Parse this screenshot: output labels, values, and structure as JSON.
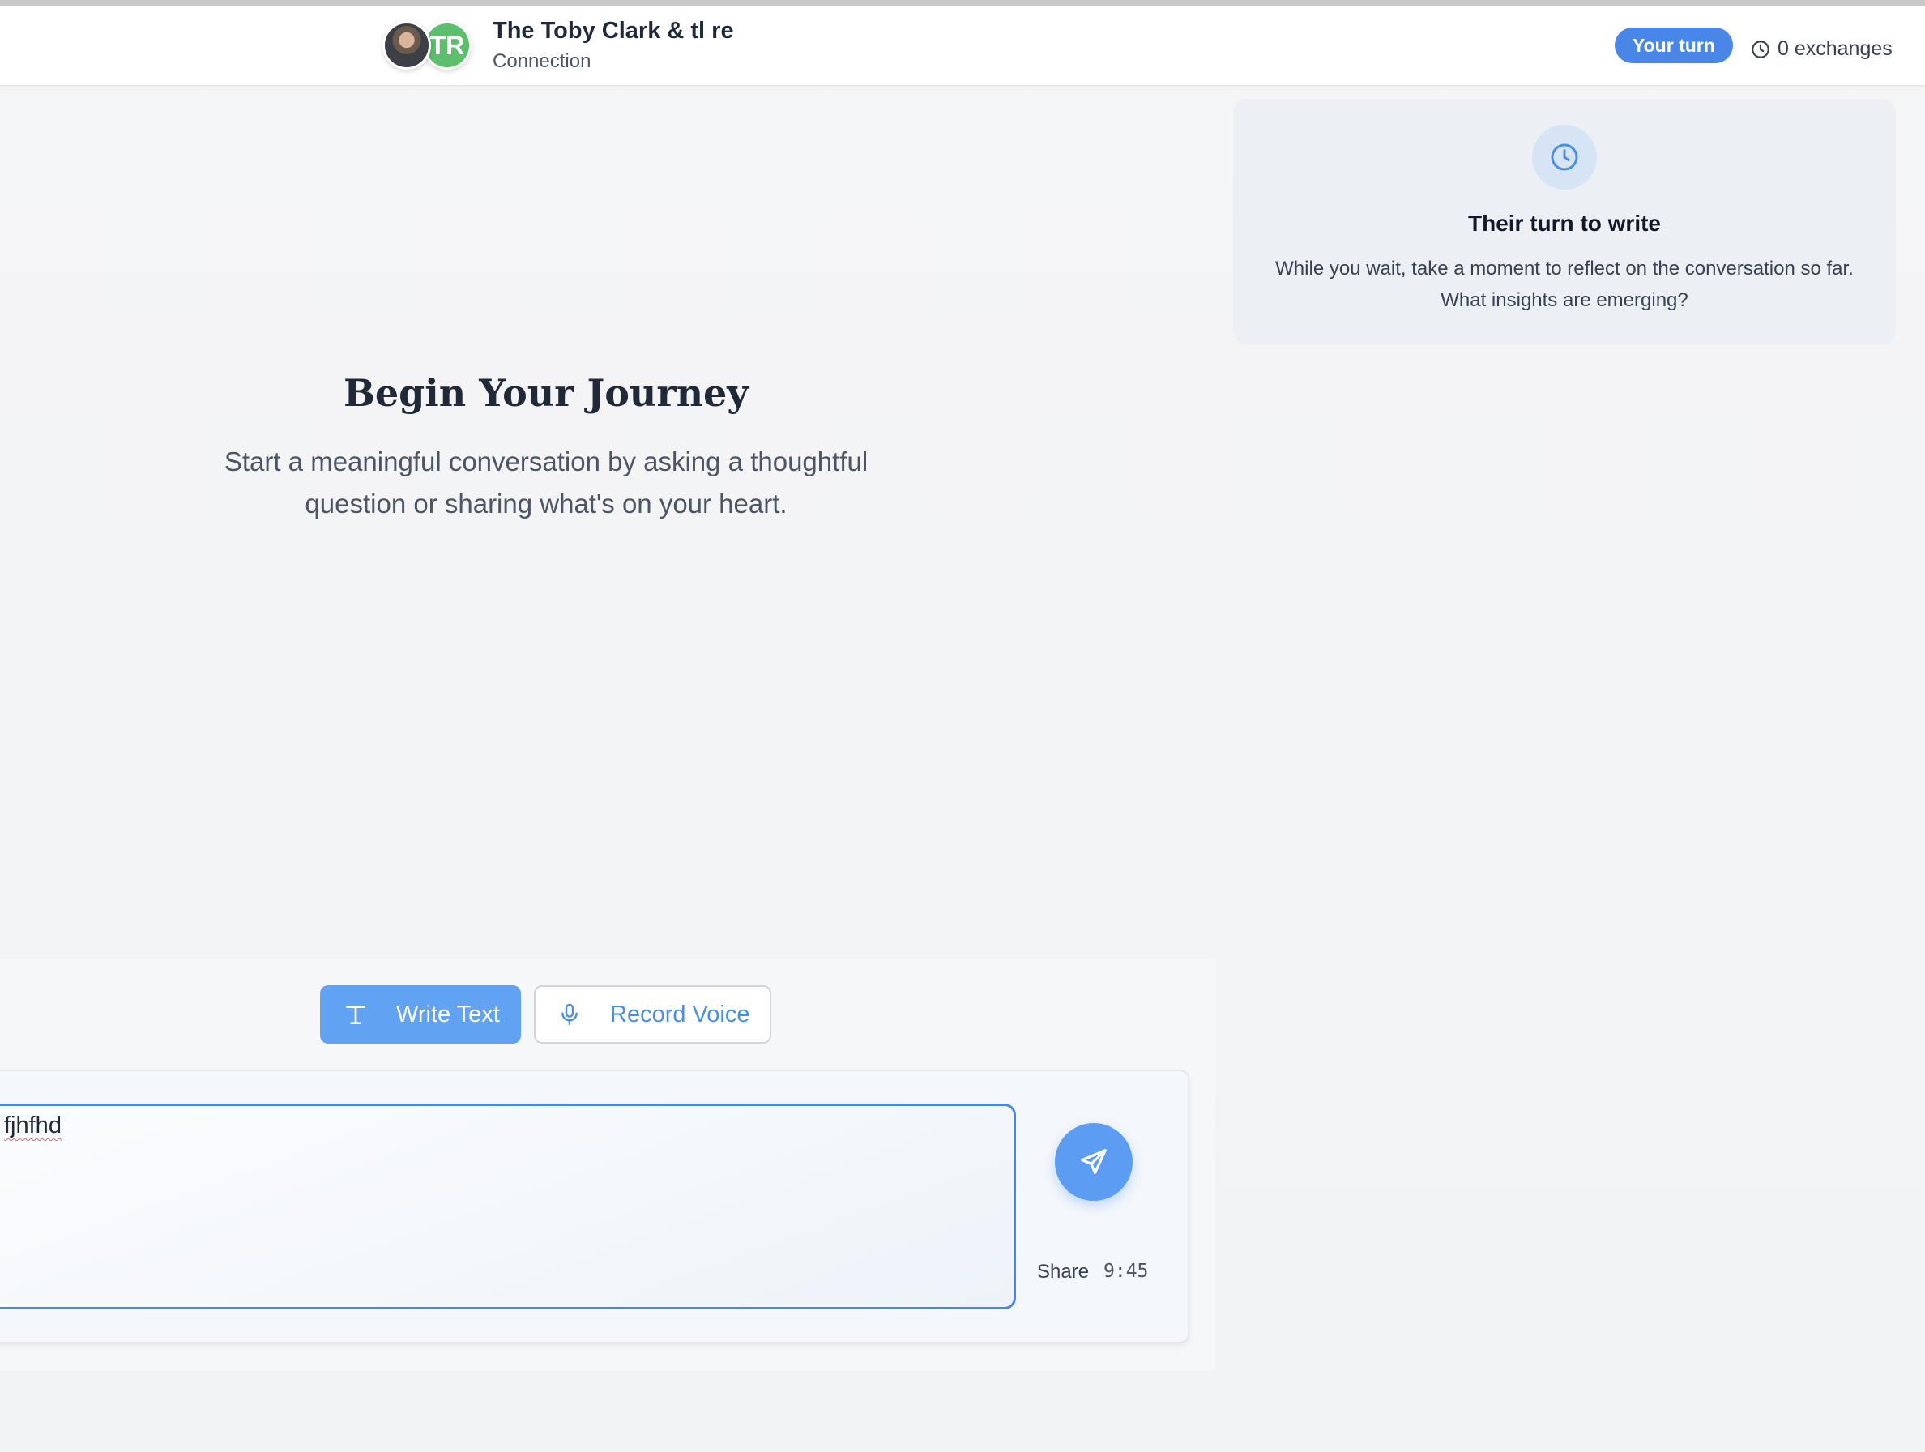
{
  "header": {
    "avatar_initials": "TR",
    "title": "The Toby Clark & tl re",
    "subtitle": "Connection",
    "turn_badge": "Your turn",
    "exchanges": "0 exchanges"
  },
  "wait_card": {
    "icon": "clock-icon",
    "title": "Their turn to write",
    "body": "While you wait, take a moment to reflect on the conversation so far. What insights are emerging?"
  },
  "intro": {
    "title": "Begin Your Journey",
    "body": "Start a meaningful conversation by asking a thoughtful question or sharing what's on your heart."
  },
  "composer": {
    "modes": [
      {
        "label": "Write Text",
        "icon": "text-icon",
        "active": true
      },
      {
        "label": "Record Voice",
        "icon": "microphone-icon",
        "active": false
      }
    ],
    "input_value": "fjhfhd",
    "send_icon": "send-icon",
    "share_label": "Share",
    "share_time": "9:45"
  },
  "colors": {
    "accent": "#4a86e8",
    "send_button": "#5c9cf2",
    "avatar_green": "#5cbf6b",
    "wait_card_bg": "#eceff4"
  }
}
